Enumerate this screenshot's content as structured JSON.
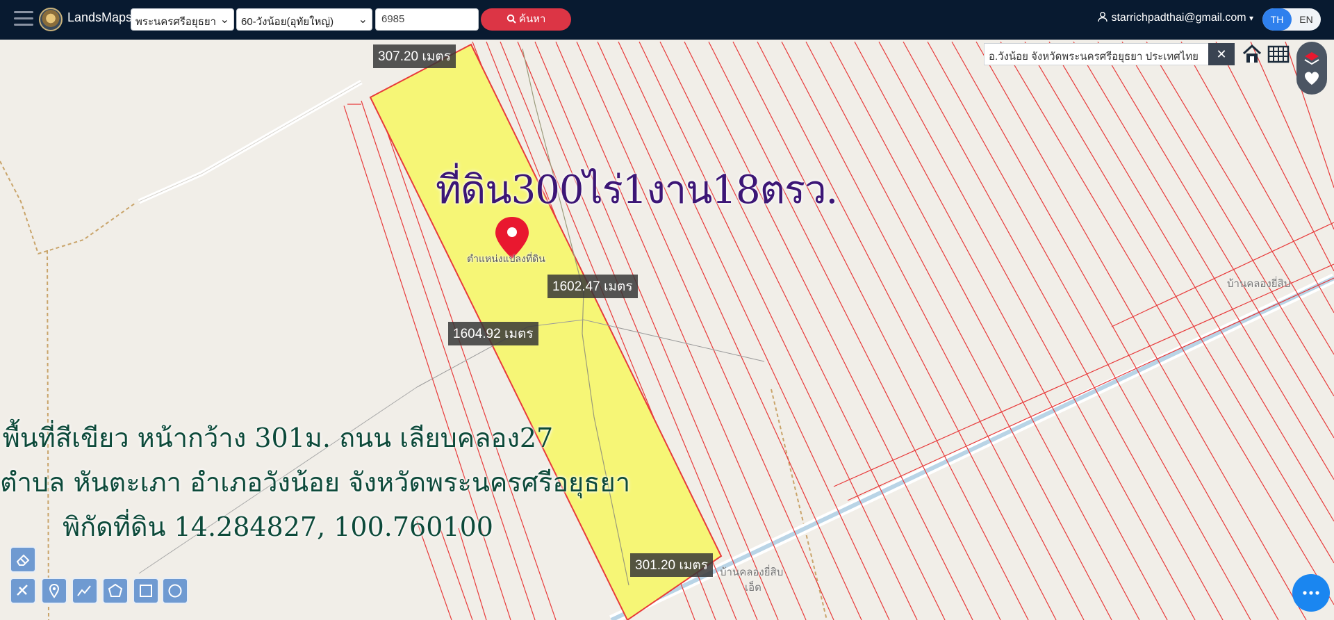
{
  "header": {
    "brand": "LandsMaps",
    "province_select": "พระนครศรีอยุธยา",
    "district_select": "60-วังน้อย(อุทัยใหญ่)",
    "parcel_input": "6985",
    "search_label": "ค้นหา",
    "user_email": "starrichpadthai@gmail.com",
    "lang_th": "TH",
    "lang_en": "EN"
  },
  "map": {
    "address_box": "อ.วังน้อย จังหวัดพระนครศรีอยุธยา ประเทศไทย",
    "close_label": "✕",
    "title": "ที่ดิน300ไร่1งาน18ตรว.",
    "pin_label": "ตำแหน่งแปลงที่ดิน",
    "measurements": {
      "top": "307.20 เมตร",
      "right": "1602.47 เมตร",
      "left": "1604.92 เมตร",
      "bottom": "301.20 เมตร"
    },
    "info_lines": [
      "พื้นที่สีเขียว หน้ากว้าง 301ม. ถนน เลียบคลอง27",
      "ตำบล หันตะเภา อำเภอวังน้อย จังหวัดพระนครศรีอยุธยา",
      "พิกัดที่ดิน 14.284827, 100.760100"
    ],
    "place_names": {
      "village_top_right": "บ้านคลองยี่สิบ",
      "village_bottom": "บ้านคลองยี่สิบ",
      "village_bottom_2": "เอ็ด"
    },
    "colors": {
      "parcel_fill": "#f6f676",
      "parcel_lines": "#e83a3a",
      "title_color": "#3c1676",
      "info_color": "#0d4a3a",
      "header_bg": "#081a30",
      "search_button": "#dc3545",
      "tool_button": "#6f9ad1"
    },
    "tools": [
      "eraser-icon",
      "ruler-icon",
      "pin-icon",
      "polyline-icon",
      "polygon-icon",
      "rectangle-icon",
      "circle-icon"
    ]
  }
}
